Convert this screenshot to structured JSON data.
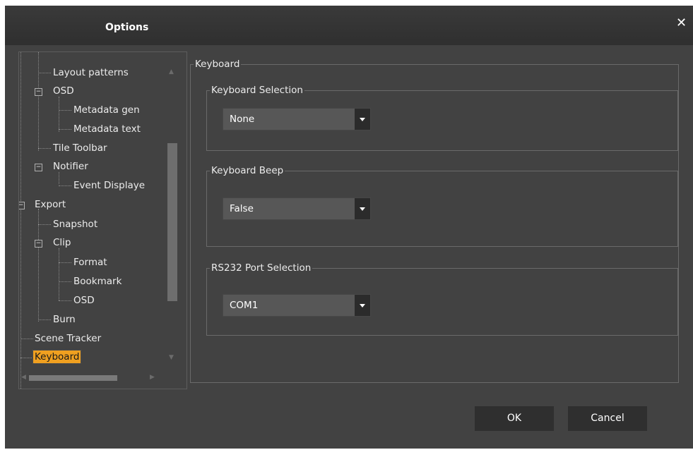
{
  "window": {
    "title": "Options",
    "close_glyph": "✕"
  },
  "tree": {
    "items": [
      {
        "label": "Layout patterns"
      },
      {
        "label": "OSD"
      },
      {
        "label": "Metadata gen"
      },
      {
        "label": "Metadata text"
      },
      {
        "label": "Tile Toolbar"
      },
      {
        "label": "Notifier"
      },
      {
        "label": "Event Displaye"
      },
      {
        "label": "Export"
      },
      {
        "label": "Snapshot"
      },
      {
        "label": "Clip"
      },
      {
        "label": "Format"
      },
      {
        "label": "Bookmark"
      },
      {
        "label": "OSD"
      },
      {
        "label": "Burn"
      },
      {
        "label": "Scene Tracker"
      },
      {
        "label": "Keyboard",
        "selected": true
      }
    ]
  },
  "panel": {
    "title": "Keyboard",
    "groups": [
      {
        "title": "Keyboard Selection",
        "value": "None"
      },
      {
        "title": "Keyboard Beep",
        "value": "False"
      },
      {
        "title": "RS232 Port Selection",
        "value": "COM1"
      }
    ]
  },
  "buttons": {
    "ok": "OK",
    "cancel": "Cancel"
  },
  "colors": {
    "selected_bg": "#f0a020",
    "dialog_bg": "#424242",
    "button_bg": "#2f2f2f"
  }
}
